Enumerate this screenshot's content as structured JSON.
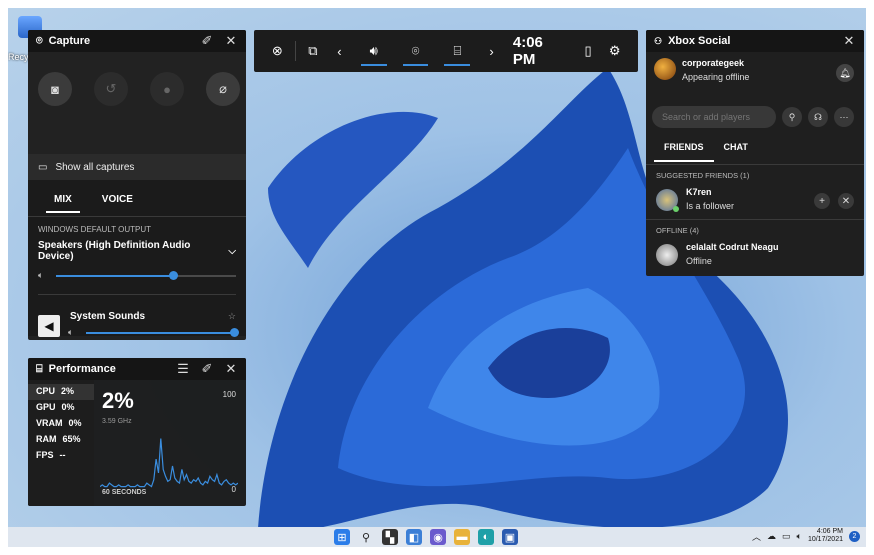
{
  "desktop": {
    "icon_label": "Recy"
  },
  "capture": {
    "title": "Capture",
    "show_all": "Show all captures",
    "tabs": [
      "MIX",
      "VOICE"
    ],
    "output_label": "WINDOWS DEFAULT OUTPUT",
    "device": "Speakers (High Definition Audio Device)",
    "device_volume_fraction": 0.65,
    "system_sounds": "System Sounds",
    "system_volume_fraction": 1.0
  },
  "performance": {
    "title": "Performance",
    "items": [
      {
        "label": "CPU",
        "value": "2%"
      },
      {
        "label": "GPU",
        "value": "0%"
      },
      {
        "label": "VRAM",
        "value": "0%"
      },
      {
        "label": "RAM",
        "value": "65%"
      },
      {
        "label": "FPS",
        "value": "--"
      }
    ],
    "big_value": "2%",
    "max_label": "100",
    "min_label": "0",
    "freq": "3.59 GHz",
    "window_label": "60 SECONDS",
    "history": [
      2,
      3,
      2,
      2,
      4,
      3,
      2,
      2,
      3,
      2,
      2,
      2,
      3,
      2,
      2,
      2,
      3,
      2,
      2,
      2,
      4,
      3,
      2,
      6,
      18,
      10,
      30,
      12,
      8,
      5,
      6,
      14,
      7,
      5,
      4,
      12,
      6,
      9,
      5,
      4,
      6,
      5,
      7,
      4,
      3,
      5,
      4,
      8,
      6,
      5,
      9,
      4,
      3,
      5,
      6,
      4,
      3,
      4,
      3,
      4
    ]
  },
  "topbar": {
    "time": "4:06 PM"
  },
  "social": {
    "title": "Xbox Social",
    "me_name": "corporategeek",
    "me_status": "Appearing offline",
    "search_placeholder": "Search or add players",
    "tabs": [
      "FRIENDS",
      "CHAT"
    ],
    "suggested_label": "SUGGESTED FRIENDS (1)",
    "suggested": {
      "name": "K7ren",
      "sub": "Is a follower"
    },
    "offline_label": "OFFLINE (4)",
    "offline": {
      "name": "celalalt Codrut Neagu",
      "sub": "Offline"
    }
  },
  "taskbar": {
    "time": "4:06 PM",
    "date": "10/17/2021",
    "notifications": "2"
  }
}
